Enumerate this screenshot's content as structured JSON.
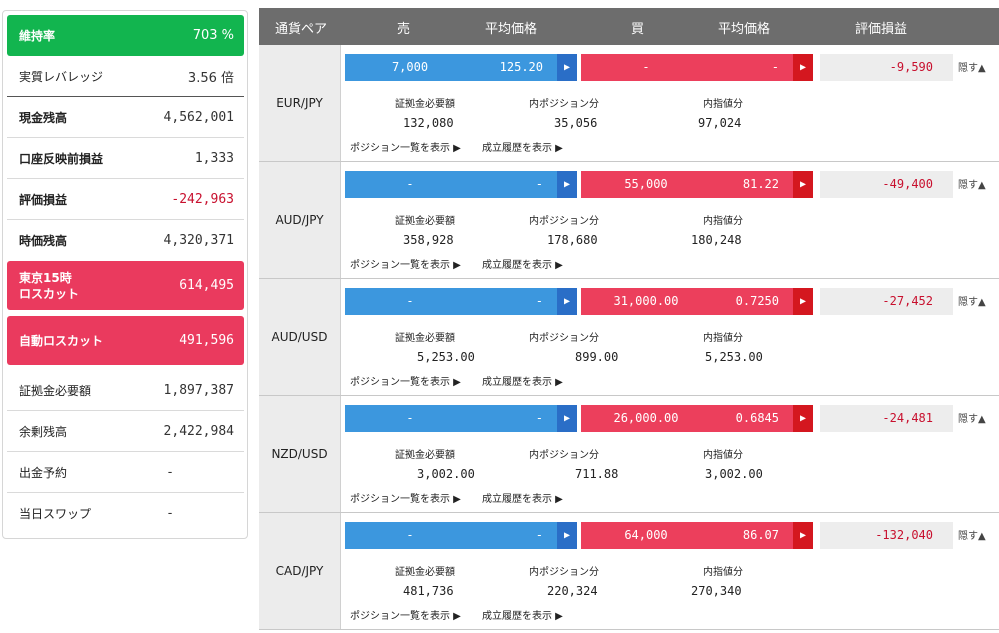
{
  "summary": {
    "rows": [
      {
        "label": "維持率",
        "value": "703 %",
        "style": "green"
      },
      {
        "label": "実質レバレッジ",
        "value": "3.56 倍",
        "style": "leverage"
      },
      {
        "label": "現金残高",
        "value": "4,562,001",
        "style": "bold"
      },
      {
        "label": "口座反映前損益",
        "value": "1,333",
        "style": "bold"
      },
      {
        "label": "評価損益",
        "value": "-242,963",
        "style": "bold-neg"
      },
      {
        "label": "時価残高",
        "value": "4,320,371",
        "style": "bold"
      },
      {
        "label": "東京15時\nロスカット",
        "value": "614,495",
        "style": "red"
      },
      {
        "label": "自動ロスカット",
        "value": "491,596",
        "style": "red"
      },
      {
        "label": "証拠金必要額",
        "value": "1,897,387",
        "style": "plain"
      },
      {
        "label": "余剰残高",
        "value": "2,422,984",
        "style": "plain"
      },
      {
        "label": "出金予約",
        "value": "-",
        "style": "plain"
      },
      {
        "label": "当日スワップ",
        "value": "-",
        "style": "plain"
      }
    ]
  },
  "table": {
    "headers": {
      "pair": "通貨ペア",
      "sell": "売",
      "sell_avg": "平均価格",
      "buy": "買",
      "buy_avg": "平均価格",
      "pl": "評価損益"
    },
    "sub_labels": {
      "margin": "証拠金必要額",
      "inpos": "内ポジション分",
      "inlimit": "内指値分"
    },
    "links": {
      "positions": "ポジション一覧を表示 ▶",
      "history": "成立履歴を表示 ▶"
    },
    "hide_label": "隠す▲",
    "arrow": "▶",
    "rows": [
      {
        "pair": "EUR/JPY",
        "sell_qty": "7,000",
        "sell_avg": "125.20",
        "buy_qty": "-",
        "buy_avg": "-",
        "pl": "-9,590",
        "margin": "132,080",
        "inpos": "35,056",
        "inlimit": "97,024"
      },
      {
        "pair": "AUD/JPY",
        "sell_qty": "-",
        "sell_avg": "-",
        "buy_qty": "55,000",
        "buy_avg": "81.22",
        "pl": "-49,400",
        "margin": "358,928",
        "inpos": "178,680",
        "inlimit": "180,248"
      },
      {
        "pair": "AUD/USD",
        "sell_qty": "-",
        "sell_avg": "-",
        "buy_qty": "31,000.00",
        "buy_avg": "0.7250",
        "pl": "-27,452",
        "margin": "5,253.00",
        "inpos": "899.00",
        "inlimit": "5,253.00"
      },
      {
        "pair": "NZD/USD",
        "sell_qty": "-",
        "sell_avg": "-",
        "buy_qty": "26,000.00",
        "buy_avg": "0.6845",
        "pl": "-24,481",
        "margin": "3,002.00",
        "inpos": "711.88",
        "inlimit": "3,002.00"
      },
      {
        "pair": "CAD/JPY",
        "sell_qty": "-",
        "sell_avg": "-",
        "buy_qty": "64,000",
        "buy_avg": "86.07",
        "pl": "-132,040",
        "margin": "481,736",
        "inpos": "220,324",
        "inlimit": "270,340"
      }
    ]
  },
  "colors": {
    "green": "#12b54f",
    "pink": "#ea3a5e",
    "blue": "#3c97de",
    "header": "#6d6d6d",
    "negative": "#c8102e"
  }
}
